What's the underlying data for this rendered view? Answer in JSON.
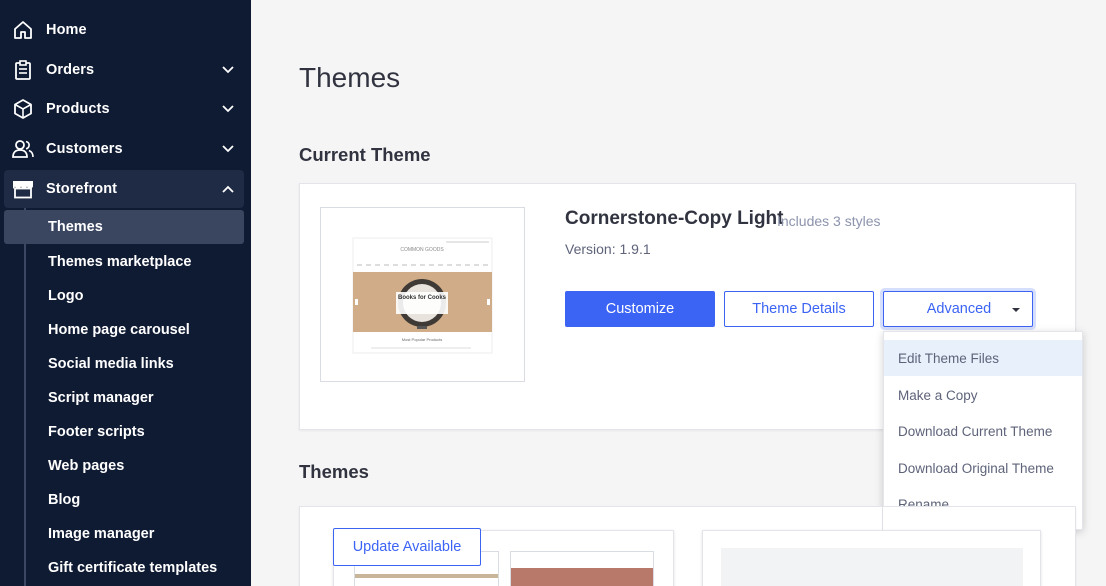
{
  "sidebar": {
    "items": [
      {
        "label": "Home",
        "icon": "home-icon"
      },
      {
        "label": "Orders",
        "icon": "orders-icon"
      },
      {
        "label": "Products",
        "icon": "products-icon"
      },
      {
        "label": "Customers",
        "icon": "customers-icon"
      },
      {
        "label": "Storefront",
        "icon": "storefront-icon"
      }
    ],
    "sub_items": [
      "Themes",
      "Themes marketplace",
      "Logo",
      "Home page carousel",
      "Social media links",
      "Script manager",
      "Footer scripts",
      "Web pages",
      "Blog",
      "Image manager",
      "Gift certificate templates"
    ]
  },
  "main": {
    "page_title": "Themes",
    "current_theme_heading": "Current Theme",
    "themes_heading": "Themes",
    "current_theme": {
      "name": "Cornerstone-Copy Light",
      "styles": "Includes 3 styles",
      "version": "Version: 1.9.1",
      "preview": {
        "header_text": "COMMON GOODS",
        "banner_text": "Books for Cooks",
        "footer_text": "Most Popular Products"
      }
    },
    "buttons": {
      "customize": "Customize",
      "theme_details": "Theme Details",
      "advanced": "Advanced"
    },
    "advanced_menu": [
      "Edit Theme Files",
      "Make a Copy",
      "Download Current Theme",
      "Download Original Theme",
      "Rename"
    ],
    "update_available": "Update Available"
  },
  "colors": {
    "sidebar_bg": "#0f1b33",
    "accent": "#3c64f4",
    "menu_highlight": "#e7f0fb"
  }
}
